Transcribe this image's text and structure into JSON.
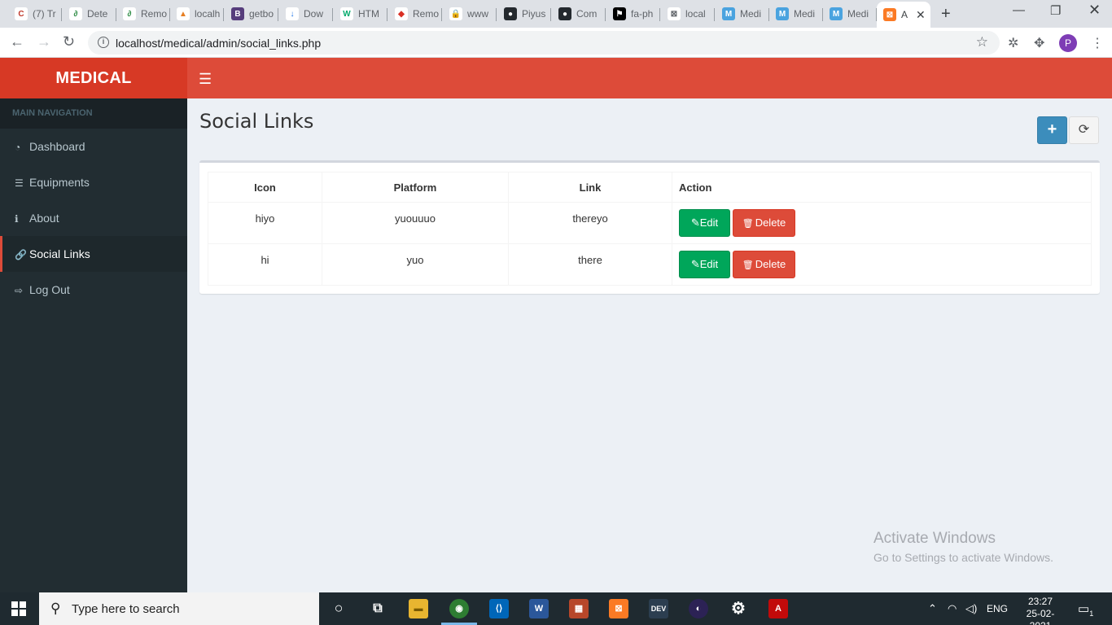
{
  "browser": {
    "tabs": [
      {
        "label": "(7) Tr",
        "color": "#ffffff",
        "glyph": "C",
        "fg": "#c0392b"
      },
      {
        "label": "Dete",
        "color": "#ffffff",
        "glyph": "∂",
        "fg": "#2f8d46"
      },
      {
        "label": "Remo",
        "color": "#ffffff",
        "glyph": "∂",
        "fg": "#2f8d46"
      },
      {
        "label": "localh",
        "color": "#ffffff",
        "glyph": "▲",
        "fg": "#e67e22"
      },
      {
        "label": "getbo",
        "color": "#563d7c",
        "glyph": "B",
        "fg": "#ffffff"
      },
      {
        "label": "Dow",
        "color": "#ffffff",
        "glyph": "↓",
        "fg": "#1a73e8"
      },
      {
        "label": "HTM",
        "color": "#ffffff",
        "glyph": "W",
        "fg": "#04aa6d"
      },
      {
        "label": "Remo",
        "color": "#ffffff",
        "glyph": "◆",
        "fg": "#d93025"
      },
      {
        "label": "www",
        "color": "#ffffff",
        "glyph": "🔒",
        "fg": "#5f6368"
      },
      {
        "label": "Piyus",
        "color": "#24292e",
        "glyph": "●",
        "fg": "#ffffff"
      },
      {
        "label": "Com",
        "color": "#24292e",
        "glyph": "●",
        "fg": "#ffffff"
      },
      {
        "label": "fa-ph",
        "color": "#000000",
        "glyph": "⚑",
        "fg": "#ffffff"
      },
      {
        "label": "local",
        "color": "#ffffff",
        "glyph": "⊠",
        "fg": "#5f6368"
      },
      {
        "label": "Medi",
        "color": "#4aa3df",
        "glyph": "M",
        "fg": "#ffffff"
      },
      {
        "label": "Medi",
        "color": "#4aa3df",
        "glyph": "M",
        "fg": "#ffffff"
      },
      {
        "label": "Medi",
        "color": "#4aa3df",
        "glyph": "M",
        "fg": "#ffffff"
      }
    ],
    "active_tab": {
      "label": "A",
      "color": "#fb7a24",
      "glyph": "⊠"
    },
    "url": "localhost/medical/admin/social_links.php",
    "profile_initial": "P"
  },
  "app": {
    "logo": "MEDICAL",
    "nav_header": "MAIN NAVIGATION",
    "nav_items": [
      {
        "label": "Dashboard",
        "icon": "tachometer-icon",
        "glyph": "◔"
      },
      {
        "label": "Equipments",
        "icon": "list-icon",
        "glyph": "☰"
      },
      {
        "label": "About",
        "icon": "info-circle-icon",
        "glyph": "ℹ"
      },
      {
        "label": "Social Links",
        "icon": "chain-link-icon",
        "glyph": "🔗"
      },
      {
        "label": "Log Out",
        "icon": "sign-out-icon",
        "glyph": "⇨"
      }
    ],
    "active_nav": "Social Links",
    "page_title": "Social Links",
    "add_glyph": "+",
    "refresh_glyph": "⟳",
    "table": {
      "headers": [
        "Icon",
        "Platform",
        "Link",
        "Action"
      ],
      "rows": [
        {
          "icon": "hiyo",
          "platform": "yuouuuo",
          "link": "thereyo"
        },
        {
          "icon": "hi",
          "platform": "yuo",
          "link": "there"
        }
      ],
      "edit_label": "Edit",
      "delete_label": "Delete"
    },
    "watermark": {
      "line1": "Activate Windows",
      "line2": "Go to Settings to activate Windows."
    }
  },
  "taskbar": {
    "search_placeholder": "Type here to search",
    "lang": "ENG",
    "time": "23:27",
    "date": "25-02-2021",
    "notification_count": "1"
  }
}
